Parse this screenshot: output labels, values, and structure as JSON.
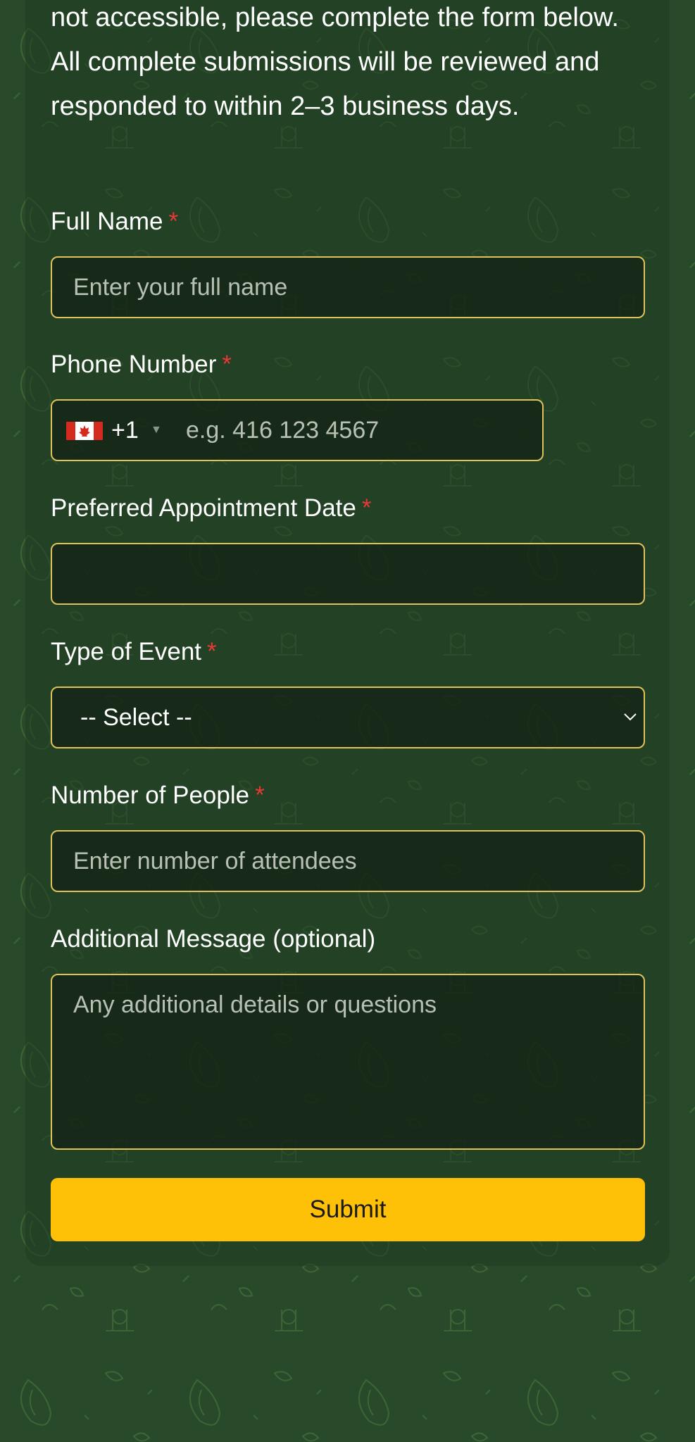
{
  "intro": {
    "text": "not accessible, please complete the form below. All complete submissions will be reviewed and responded to within 2–3 business days."
  },
  "form": {
    "full_name": {
      "label": "Full Name",
      "required_mark": "*",
      "placeholder": "Enter your full name"
    },
    "phone": {
      "label": "Phone Number",
      "required_mark": "*",
      "country_flag": "canada-flag-icon",
      "dial_code": "+1",
      "placeholder": "e.g. 416 123 4567"
    },
    "appointment_date": {
      "label": "Preferred Appointment Date",
      "required_mark": "*"
    },
    "event_type": {
      "label": "Type of Event",
      "required_mark": "*",
      "selected": "-- Select --"
    },
    "people": {
      "label": "Number of People",
      "required_mark": "*",
      "placeholder": "Enter number of attendees"
    },
    "message": {
      "label": "Additional Message (optional)",
      "placeholder": "Any additional details or questions"
    },
    "submit_label": "Submit"
  },
  "colors": {
    "background": "#284a2b",
    "field_border": "#e0c25a",
    "accent": "#ffc107",
    "required": "#e53935"
  }
}
